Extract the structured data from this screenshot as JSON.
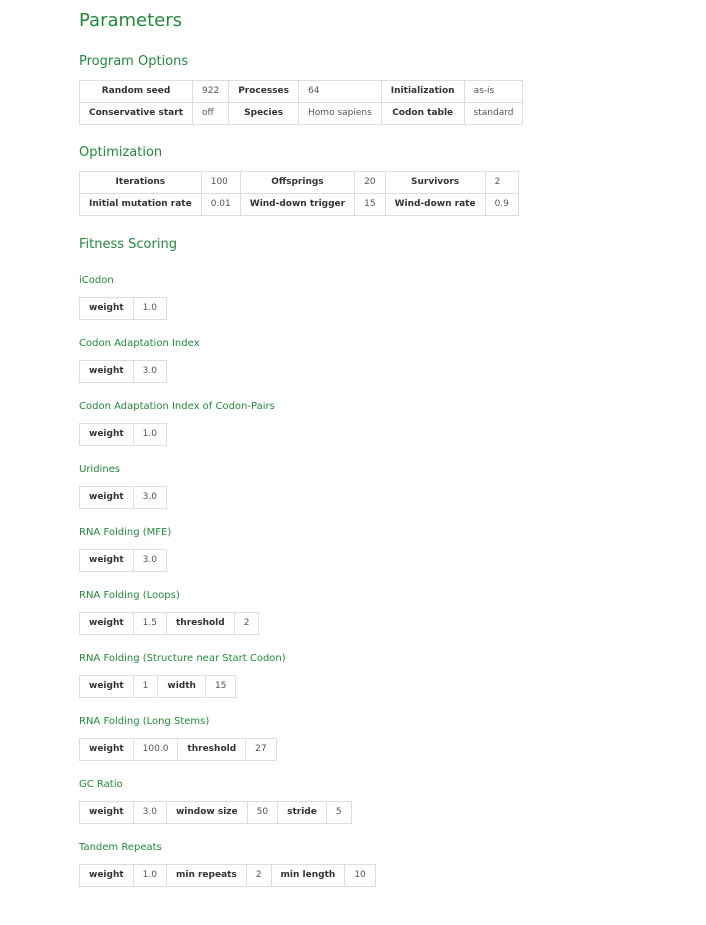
{
  "title": "Parameters",
  "program_options": {
    "heading": "Program Options",
    "rows": [
      [
        {
          "label": "Random seed",
          "value": "922"
        },
        {
          "label": "Processes",
          "value": "64"
        },
        {
          "label": "Initialization",
          "value": "as-is"
        }
      ],
      [
        {
          "label": "Conservative start",
          "value": "off"
        },
        {
          "label": "Species",
          "value": "Homo sapiens"
        },
        {
          "label": "Codon table",
          "value": "standard"
        }
      ]
    ]
  },
  "optimization": {
    "heading": "Optimization",
    "rows": [
      [
        {
          "label": "Iterations",
          "value": "100"
        },
        {
          "label": "Offsprings",
          "value": "20"
        },
        {
          "label": "Survivors",
          "value": "2"
        }
      ],
      [
        {
          "label": "Initial mutation rate",
          "value": "0.01"
        },
        {
          "label": "Wind-down trigger",
          "value": "15"
        },
        {
          "label": "Wind-down rate",
          "value": "0.9"
        }
      ]
    ]
  },
  "fitness_scoring": {
    "heading": "Fitness Scoring",
    "scorers": [
      {
        "name": "iCodon",
        "params": [
          {
            "label": "weight",
            "value": "1.0"
          }
        ]
      },
      {
        "name": "Codon Adaptation Index",
        "params": [
          {
            "label": "weight",
            "value": "3.0"
          }
        ]
      },
      {
        "name": "Codon Adaptation Index of Codon-Pairs",
        "params": [
          {
            "label": "weight",
            "value": "1.0"
          }
        ]
      },
      {
        "name": "Uridines",
        "params": [
          {
            "label": "weight",
            "value": "3.0"
          }
        ]
      },
      {
        "name": "RNA Folding (MFE)",
        "params": [
          {
            "label": "weight",
            "value": "3.0"
          }
        ]
      },
      {
        "name": "RNA Folding (Loops)",
        "params": [
          {
            "label": "weight",
            "value": "1.5"
          },
          {
            "label": "threshold",
            "value": "2"
          }
        ]
      },
      {
        "name": "RNA Folding (Structure near Start Codon)",
        "params": [
          {
            "label": "weight",
            "value": "1"
          },
          {
            "label": "width",
            "value": "15"
          }
        ]
      },
      {
        "name": "RNA Folding (Long Stems)",
        "params": [
          {
            "label": "weight",
            "value": "100.0"
          },
          {
            "label": "threshold",
            "value": "27"
          }
        ]
      },
      {
        "name": "GC Ratio",
        "params": [
          {
            "label": "weight",
            "value": "3.0"
          },
          {
            "label": "window size",
            "value": "50"
          },
          {
            "label": "stride",
            "value": "5"
          }
        ]
      },
      {
        "name": "Tandem Repeats",
        "params": [
          {
            "label": "weight",
            "value": "1.0"
          },
          {
            "label": "min repeats",
            "value": "2"
          },
          {
            "label": "min length",
            "value": "10"
          }
        ]
      }
    ]
  }
}
